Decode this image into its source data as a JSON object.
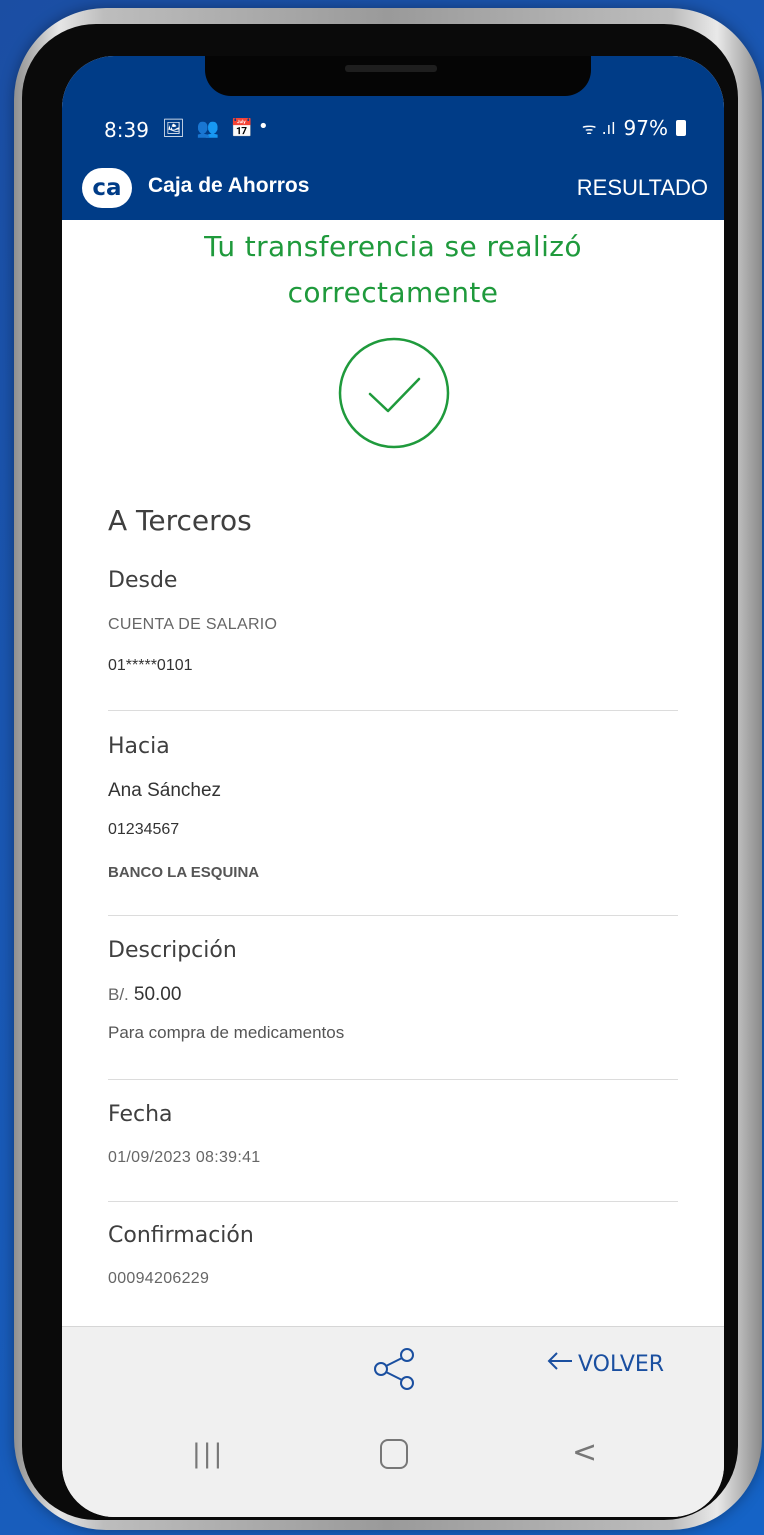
{
  "status_bar": {
    "time": "8:39",
    "notification_icons": "🖼 👥 📅",
    "dot": "•",
    "signal": "ᯤ .ıl",
    "battery": "97%"
  },
  "header": {
    "logo_text": "ca",
    "brand": "Caja de Ahorros",
    "screen_title": "RESULTADO"
  },
  "result": {
    "message": "Tu transferencia se realizó correctamente",
    "icon": "check-circle-icon",
    "success_color": "#1f9a3c"
  },
  "transfer_type": "A Terceros",
  "from": {
    "label": "Desde",
    "account_name": "CUENTA DE SALARIO",
    "account_number": "01*****0101"
  },
  "to": {
    "label": "Hacia",
    "name": "Ana Sánchez",
    "account_number": "01234567",
    "bank": "BANCO LA ESQUINA"
  },
  "description": {
    "label": "Descripción",
    "currency": "B/.",
    "amount": "50.00",
    "text": "Para compra de medicamentos"
  },
  "date": {
    "label": "Fecha",
    "value": "01/09/2023 08:39:41"
  },
  "confirmation": {
    "label": "Confirmación",
    "value": "00094206229"
  },
  "actions": {
    "share_icon": "share-icon",
    "back_label": "VOLVER"
  },
  "system_nav": {
    "recent": "|||",
    "back": "<"
  },
  "colors": {
    "brand_blue": "#003c87",
    "action_blue": "#1a4fa0"
  }
}
